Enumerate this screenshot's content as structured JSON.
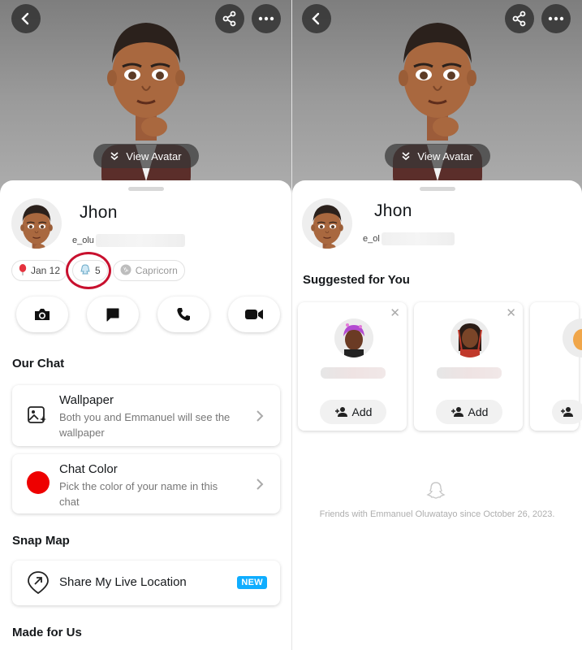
{
  "left": {
    "view_avatar": "View Avatar",
    "profile": {
      "name": "Jhon",
      "username": "e_olu"
    },
    "badges": [
      {
        "label": "Jan 12",
        "icon": "balloon-icon"
      },
      {
        "label": "5",
        "icon": "snapstar-icon"
      },
      {
        "label": "Capricorn",
        "icon": "capricorn-icon"
      }
    ],
    "actions": [
      "camera-icon",
      "chat-icon",
      "phone-icon",
      "video-icon"
    ],
    "sections": {
      "our_chat": "Our Chat",
      "snap_map": "Snap Map",
      "made_for_us": "Made for Us"
    },
    "cards": {
      "wallpaper": {
        "title": "Wallpaper",
        "subtitle": "Both you and Emmanuel will see the wallpaper"
      },
      "chat_color": {
        "title": "Chat Color",
        "subtitle": "Pick the color of your name in this chat",
        "color": "#ee0000"
      },
      "live_location": {
        "title": "Share My Live Location",
        "badge": "NEW"
      }
    }
  },
  "right": {
    "view_avatar": "View Avatar",
    "profile": {
      "name": "Jhon",
      "username": "e_ol"
    },
    "suggested_title": "Suggested for You",
    "suggestions": [
      {
        "add_label": "Add"
      },
      {
        "add_label": "Add"
      }
    ],
    "friends_since": "Friends with Emmanuel Oluwatayo since October 26, 2023."
  },
  "colors": {
    "accent_blue": "#0fadff",
    "highlight_ring": "#c8102e",
    "hero_gray": "#9a9a9a"
  }
}
